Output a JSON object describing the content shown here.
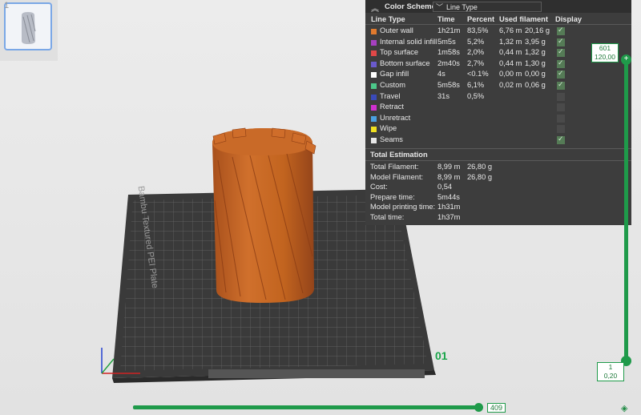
{
  "thumbnail": {
    "index": "1"
  },
  "color_scheme": {
    "title": "Color Scheme",
    "selected": "Line Type",
    "columns": [
      "Line Type",
      "Time",
      "Percent",
      "Used filament",
      "Display"
    ],
    "rows": [
      {
        "name": "Outer wall",
        "color": "#e07a2e",
        "time": "1h21m",
        "percent": "83,5%",
        "len": "6,76 m",
        "weight": "20,16 g",
        "display": true
      },
      {
        "name": "Internal solid infill",
        "color": "#a640c0",
        "time": "5m5s",
        "percent": "5,2%",
        "len": "1,32 m",
        "weight": "3,95 g",
        "display": true
      },
      {
        "name": "Top surface",
        "color": "#e04848",
        "time": "1m58s",
        "percent": "2,0%",
        "len": "0,44 m",
        "weight": "1,32 g",
        "display": true
      },
      {
        "name": "Bottom surface",
        "color": "#6a5acd",
        "time": "2m40s",
        "percent": "2,7%",
        "len": "0,44 m",
        "weight": "1,30 g",
        "display": true
      },
      {
        "name": "Gap infill",
        "color": "#ffffff",
        "time": "4s",
        "percent": "<0.1%",
        "len": "0,00 m",
        "weight": "0,00 g",
        "display": true
      },
      {
        "name": "Custom",
        "color": "#4cc88a",
        "time": "5m58s",
        "percent": "6,1%",
        "len": "0,02 m",
        "weight": "0,06 g",
        "display": true
      },
      {
        "name": "Travel",
        "color": "#3a4ab8",
        "time": "31s",
        "percent": "0,5%",
        "len": "",
        "weight": "",
        "display": false
      },
      {
        "name": "Retract",
        "color": "#d030d0",
        "time": "",
        "percent": "",
        "len": "",
        "weight": "",
        "display": false
      },
      {
        "name": "Unretract",
        "color": "#4aa0e0",
        "time": "",
        "percent": "",
        "len": "",
        "weight": "",
        "display": false
      },
      {
        "name": "Wipe",
        "color": "#f0e020",
        "time": "",
        "percent": "",
        "len": "",
        "weight": "",
        "display": false
      },
      {
        "name": "Seams",
        "color": "#e8e8e8",
        "time": "",
        "percent": "",
        "len": "",
        "weight": "",
        "display": true
      }
    ]
  },
  "total_estimation": {
    "title": "Total Estimation",
    "rows": [
      {
        "label": "Total Filament:",
        "v1": "8,99 m",
        "v2": "26,80 g"
      },
      {
        "label": "Model Filament:",
        "v1": "8,99 m",
        "v2": "26,80 g"
      },
      {
        "label": "Cost:",
        "v1": "0,54",
        "v2": ""
      },
      {
        "label": "Prepare time:",
        "v1": "5m44s",
        "v2": ""
      },
      {
        "label": "Model printing time:",
        "v1": "1h31m",
        "v2": ""
      },
      {
        "label": "Total time:",
        "v1": "1h37m",
        "v2": ""
      }
    ]
  },
  "bed": {
    "plate_label": "Bambu Textured PEI Plate",
    "plate_number": "01"
  },
  "layer_slider": {
    "top_layer": "601",
    "top_height": "120,00",
    "bottom_layer": "1",
    "bottom_height": "0,20"
  },
  "move_slider": {
    "value": "409"
  }
}
